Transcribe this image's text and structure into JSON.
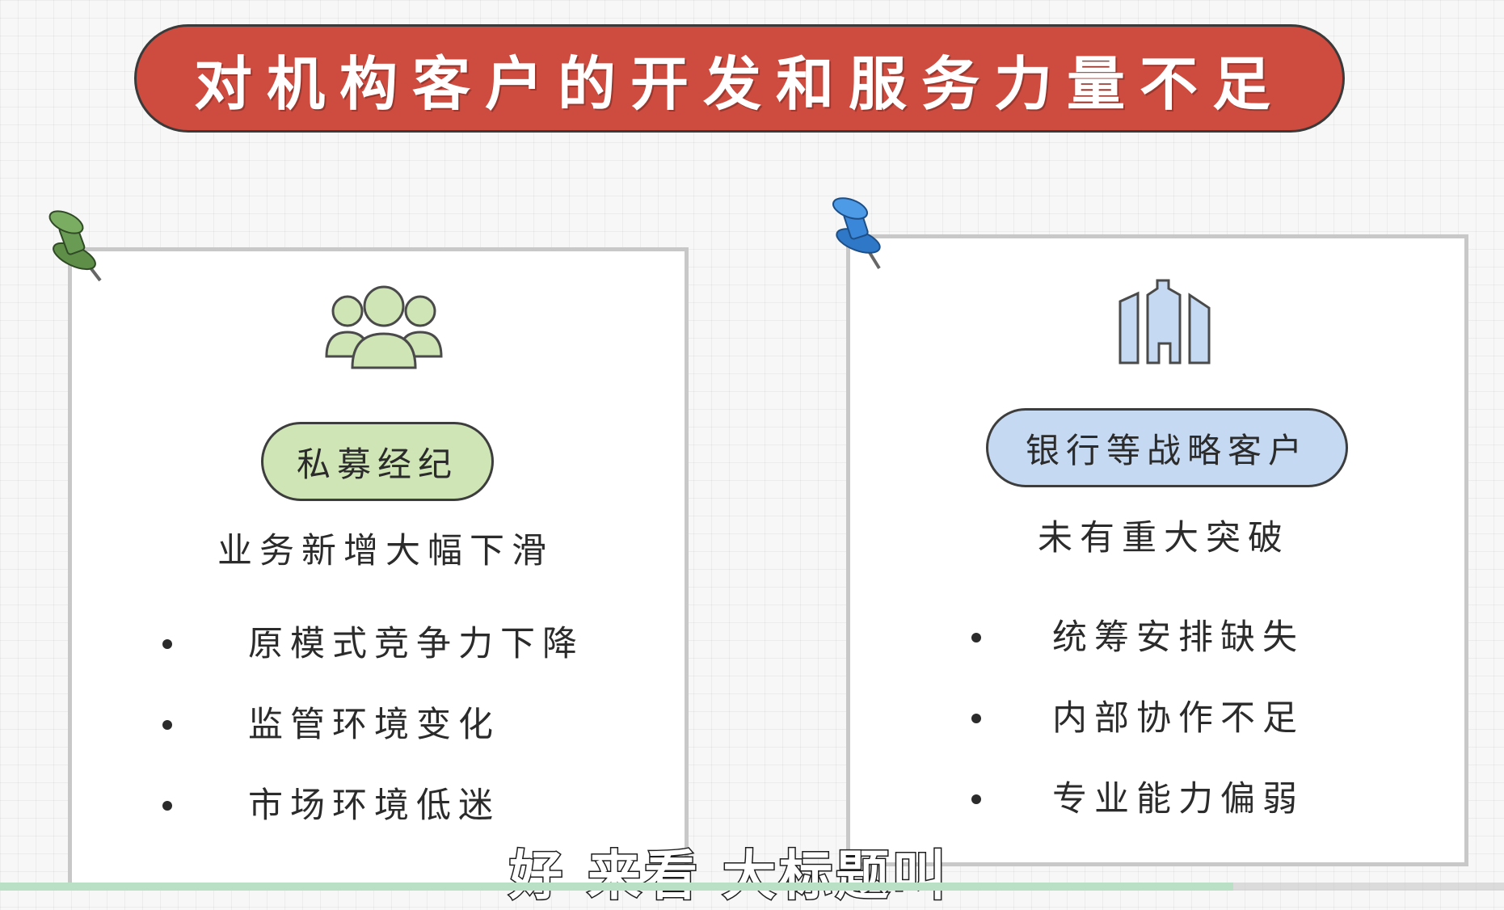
{
  "banner": {
    "title": "对机构客户的开发和服务力量不足",
    "color": "#cd4b3f"
  },
  "left_card": {
    "pin_color": "#6a9b55",
    "icon": "people-group-icon",
    "pill_label": "私募经纪",
    "pill_color": "#cfe5b6",
    "subtitle": "业务新增大幅下滑",
    "bullets": [
      "原模式竞争力下降",
      "监管环境变化",
      "市场环境低迷"
    ]
  },
  "right_card": {
    "pin_color": "#3a86d8",
    "icon": "office-building-icon",
    "pill_label": "银行等战略客户",
    "pill_color": "#c5d9f2",
    "subtitle": "未有重大突破",
    "bullets": [
      "统筹安排缺失",
      "内部协作不足",
      "专业能力偏弱"
    ]
  },
  "caption": "好 来看 大标题叫",
  "playback": {
    "progress": 0.82
  }
}
